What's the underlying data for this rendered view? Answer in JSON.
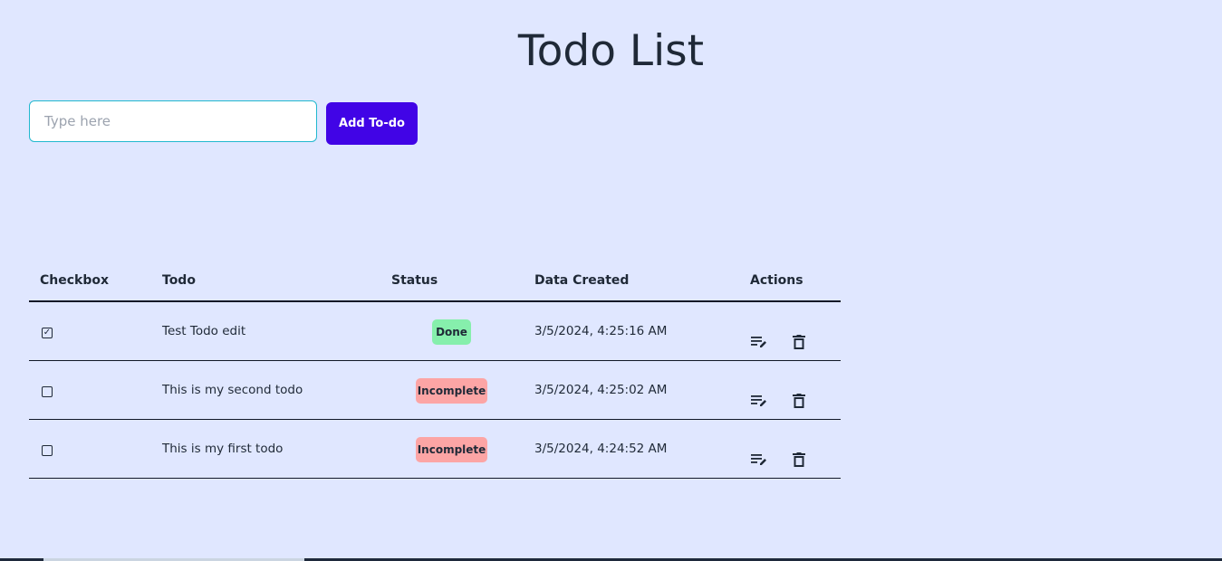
{
  "colors": {
    "background": "#e0e7ff",
    "accent": "#4104e6",
    "done_badge": "#86efac",
    "incomplete_badge": "#fca5a5"
  },
  "header": {
    "title": "Todo List"
  },
  "form": {
    "placeholder": "Type here",
    "value": "",
    "add_label": "Add To-do"
  },
  "table": {
    "columns": [
      "Checkbox",
      "Todo",
      "Status",
      "Data Created",
      "Actions"
    ],
    "rows": [
      {
        "checked": true,
        "checkbox_glyph": "✓",
        "text": "Test Todo edit",
        "status": "Done",
        "created": "3/5/2024, 4:25:16 AM"
      },
      {
        "checked": false,
        "checkbox_glyph": "",
        "text": "This is my second todo",
        "status": "Incomplete",
        "created": "3/5/2024, 4:25:02 AM"
      },
      {
        "checked": false,
        "checkbox_glyph": "",
        "text": "This is my first todo",
        "status": "Incomplete",
        "created": "3/5/2024, 4:24:52 AM"
      }
    ],
    "action_icons": [
      "edit-note-icon",
      "trash-icon"
    ]
  }
}
